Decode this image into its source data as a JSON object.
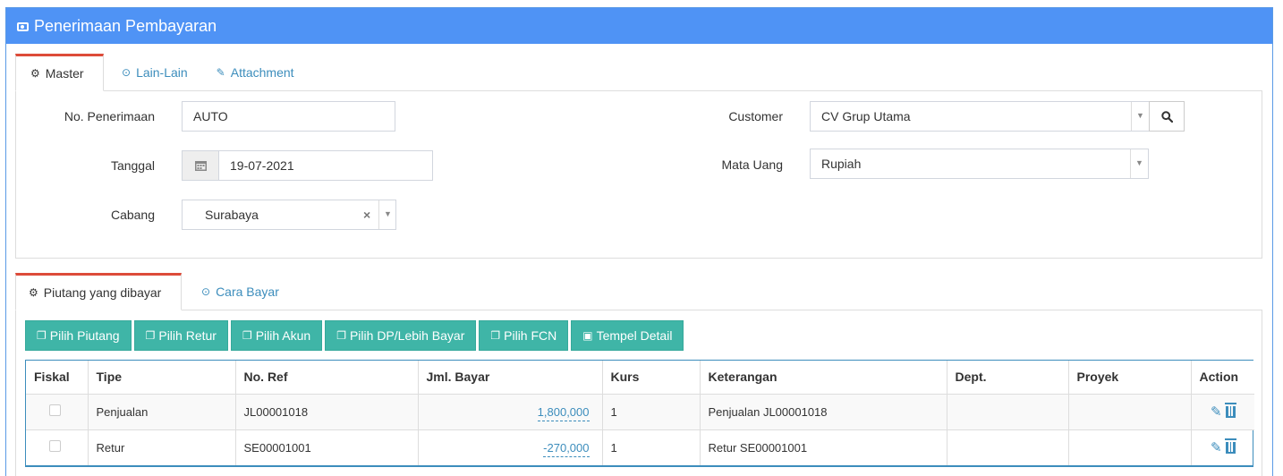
{
  "header": {
    "title": "Penerimaan Pembayaran",
    "icon": "money-icon"
  },
  "master_tabs": [
    {
      "label": "Master",
      "icon": "cogs-icon",
      "active": true
    },
    {
      "label": "Lain-Lain",
      "icon": "check-circle-icon",
      "active": false
    },
    {
      "label": "Attachment",
      "icon": "paperclip-icon",
      "active": false
    }
  ],
  "form": {
    "no_penerimaan": {
      "label": "No. Penerimaan",
      "value": "AUTO"
    },
    "tanggal": {
      "label": "Tanggal",
      "value": "19-07-2021"
    },
    "cabang": {
      "label": "Cabang",
      "value": "Surabaya",
      "clear": "×"
    },
    "customer": {
      "label": "Customer",
      "value": "CV Grup Utama"
    },
    "mata_uang": {
      "label": "Mata Uang",
      "value": "Rupiah"
    }
  },
  "detail_tabs": [
    {
      "label": "Piutang yang dibayar",
      "icon": "cogs-icon",
      "active": true
    },
    {
      "label": "Cara Bayar",
      "icon": "check-circle-icon",
      "active": false
    }
  ],
  "buttons": [
    {
      "label": "Pilih Piutang",
      "icon": "copy-icon"
    },
    {
      "label": "Pilih Retur",
      "icon": "copy-icon"
    },
    {
      "label": "Pilih Akun",
      "icon": "copy-icon"
    },
    {
      "label": "Pilih DP/Lebih Bayar",
      "icon": "copy-icon"
    },
    {
      "label": "Pilih FCN",
      "icon": "copy-icon"
    },
    {
      "label": "Tempel Detail",
      "icon": "paste-icon"
    }
  ],
  "table": {
    "columns": [
      "Fiskal",
      "Tipe",
      "No. Ref",
      "Jml. Bayar",
      "Kurs",
      "Keterangan",
      "Dept.",
      "Proyek",
      "Action"
    ],
    "rows": [
      {
        "tipe": "Penjualan",
        "no_ref": "JL00001018",
        "jml_bayar": "1,800,000",
        "kurs": "1",
        "keterangan": "Penjualan JL00001018",
        "dept": "",
        "proyek": ""
      },
      {
        "tipe": "Retur",
        "no_ref": "SE00001001",
        "jml_bayar": "-270,000",
        "kurs": "1",
        "keterangan": "Retur SE00001001",
        "dept": "",
        "proyek": ""
      }
    ]
  },
  "colors": {
    "header_bg": "#4f93f5",
    "button_bg": "#3fb5a7",
    "tab_accent": "#dd4b39",
    "link": "#3c8dbc"
  }
}
